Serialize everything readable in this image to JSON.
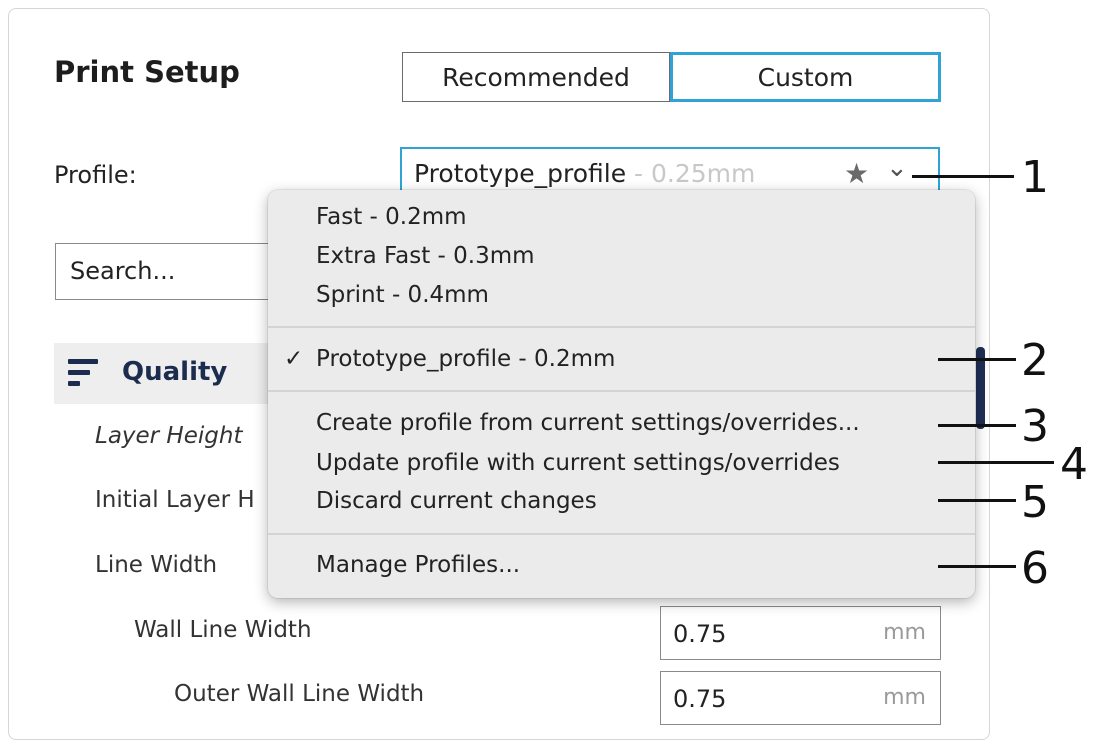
{
  "print_setup": {
    "title": "Print Setup",
    "mode_buttons": {
      "recommended": "Recommended",
      "custom": "Custom"
    },
    "profile_label": "Profile:",
    "profile_select": {
      "name": "Prototype_profile",
      "suffix": " - 0.25mm",
      "star_icon": "star-icon",
      "chevron_icon": "chevron-down-icon"
    },
    "search": {
      "placeholder": "Search..."
    },
    "quality": {
      "label": "Quality",
      "icon": "quality-lines-icon"
    },
    "settings": [
      {
        "label": "Layer Height"
      },
      {
        "label": "Initial Layer H"
      },
      {
        "label": "Line Width"
      },
      {
        "label": "Wall Line Width",
        "value": "0.75",
        "unit": "mm"
      },
      {
        "label": "Outer Wall Line Width",
        "value": "0.75",
        "unit": "mm"
      }
    ]
  },
  "dropdown_menu": {
    "section1": [
      "Fast - 0.2mm",
      "Extra Fast - 0.3mm",
      "Sprint - 0.4mm"
    ],
    "checked_item": "Prototype_profile - 0.2mm",
    "check_mark": "✓",
    "actions": [
      "Create profile from current settings/overrides...",
      "Update profile with current settings/overrides",
      "Discard current changes"
    ],
    "manage": "Manage Profiles..."
  },
  "callouts": [
    "1",
    "2",
    "3",
    "4",
    "5",
    "6"
  ],
  "colors": {
    "accent": "#30a3d6",
    "quality_text": "#1b2c4f",
    "menu_bg": "#ebebeb"
  }
}
